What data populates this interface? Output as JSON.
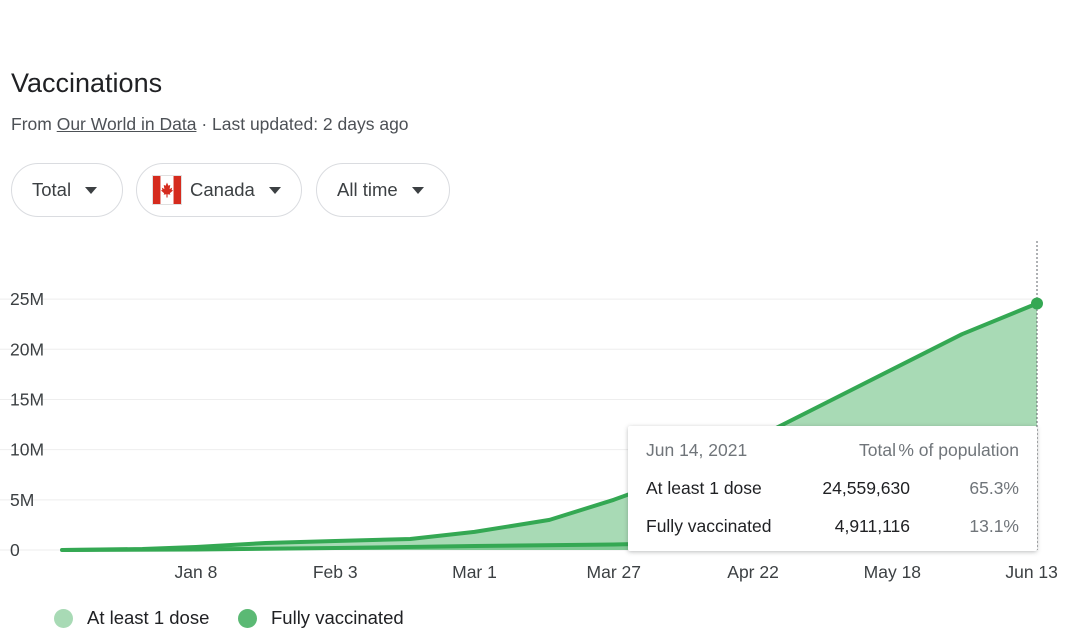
{
  "header": {
    "title": "Vaccinations",
    "source_prefix": "From",
    "source_link": "Our World in Data",
    "updated": "· Last updated: 2 days ago"
  },
  "filters": {
    "measure": "Total",
    "country": "Canada",
    "range": "All time"
  },
  "colors": {
    "dose1_fill": "#a8dab5",
    "line": "#34a853",
    "fully_fill": "#81c995",
    "fully_dot": "#5bb974",
    "grid": "#eeeeee"
  },
  "chart_data": {
    "type": "area",
    "y_ticks": [
      "0",
      "5M",
      "10M",
      "15M",
      "20M",
      "25M"
    ],
    "x_ticks": [
      "Jan 8",
      "Feb 3",
      "Mar 1",
      "Mar 27",
      "Apr 22",
      "May 18",
      "Jun 13"
    ],
    "ylim": [
      0,
      27000000
    ],
    "x_domain": [
      "2020-12-14",
      "2021-06-14"
    ],
    "series": [
      {
        "name": "At least 1 dose",
        "points": [
          [
            "2020-12-14",
            0
          ],
          [
            "2020-12-29",
            100000
          ],
          [
            "2021-01-08",
            300000
          ],
          [
            "2021-01-21",
            700000
          ],
          [
            "2021-02-03",
            900000
          ],
          [
            "2021-02-17",
            1100000
          ],
          [
            "2021-03-01",
            1800000
          ],
          [
            "2021-03-15",
            3000000
          ],
          [
            "2021-03-27",
            5000000
          ],
          [
            "2021-04-09",
            7500000
          ],
          [
            "2021-04-22",
            11000000
          ],
          [
            "2021-05-05",
            14500000
          ],
          [
            "2021-05-18",
            18000000
          ],
          [
            "2021-05-31",
            21500000
          ],
          [
            "2021-06-14",
            24559630
          ]
        ]
      },
      {
        "name": "Fully vaccinated",
        "points": [
          [
            "2020-12-14",
            0
          ],
          [
            "2021-01-08",
            50000
          ],
          [
            "2021-02-03",
            200000
          ],
          [
            "2021-03-01",
            400000
          ],
          [
            "2021-03-27",
            550000
          ],
          [
            "2021-04-22",
            900000
          ],
          [
            "2021-05-18",
            1700000
          ],
          [
            "2021-06-14",
            4911116
          ]
        ]
      }
    ]
  },
  "tooltip": {
    "date": "Jun 14, 2021",
    "col_total": "Total",
    "col_pct": "% of population",
    "rows": [
      {
        "label": "At least 1 dose",
        "total": "24,559,630",
        "pct": "65.3%"
      },
      {
        "label": "Fully vaccinated",
        "total": "4,911,116",
        "pct": "13.1%"
      }
    ]
  },
  "legend": [
    "At least 1 dose",
    "Fully vaccinated"
  ]
}
